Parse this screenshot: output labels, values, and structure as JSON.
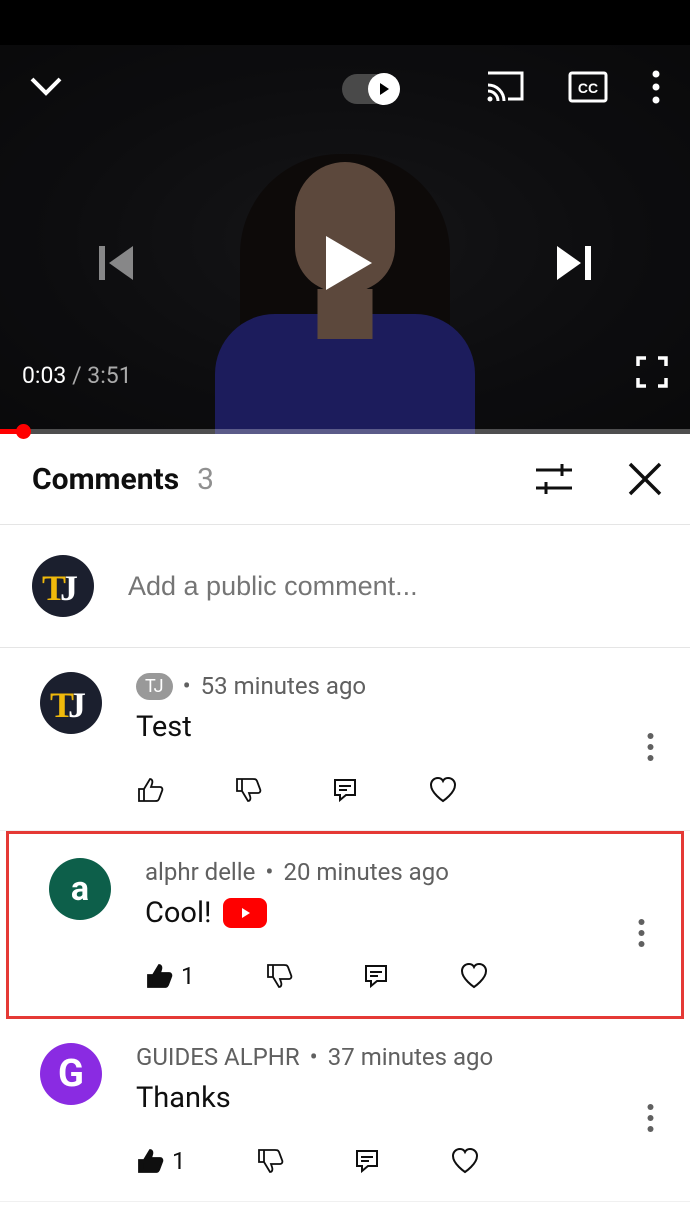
{
  "player": {
    "current_time": "0:03",
    "duration": "3:51"
  },
  "comments_header": {
    "title": "Comments",
    "count": "3"
  },
  "add_comment": {
    "placeholder": "Add a public comment...",
    "user_avatar": "TJ"
  },
  "comments": [
    {
      "author": "TJ",
      "badge": "TJ",
      "time": "53 minutes ago",
      "text": "Test",
      "likes": "",
      "liked": false,
      "avatar_letter": "TJ",
      "avatar_color": "tj",
      "has_emoji": false,
      "highlighted": false
    },
    {
      "author": "alphr delle",
      "badge": "",
      "time": "20 minutes ago",
      "text": "Cool!",
      "likes": "1",
      "liked": true,
      "avatar_letter": "a",
      "avatar_color": "green",
      "has_emoji": true,
      "highlighted": true
    },
    {
      "author": "GUIDES ALPHR",
      "badge": "",
      "time": "37 minutes ago",
      "text": "Thanks",
      "likes": "1",
      "liked": true,
      "avatar_letter": "G",
      "avatar_color": "purple",
      "has_emoji": false,
      "highlighted": false
    }
  ]
}
